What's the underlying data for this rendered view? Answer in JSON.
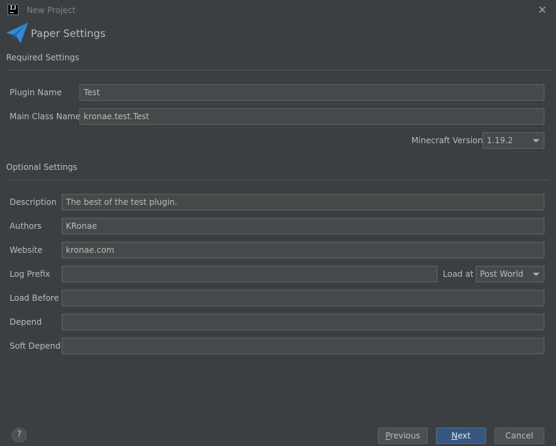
{
  "window": {
    "title": "New Project",
    "app_icon_text": "IJ"
  },
  "header": {
    "title": "Paper Settings",
    "icon": "paper-plane-icon",
    "accent": "#2f8dd8"
  },
  "required": {
    "section_title": "Required Settings",
    "plugin_name": {
      "label": "Plugin Name",
      "value": "Test"
    },
    "main_class": {
      "label": "Main Class Name",
      "value": "kronae.test.Test"
    },
    "minecraft_version": {
      "label": "Minecraft Version",
      "value": "1.19.2"
    }
  },
  "optional": {
    "section_title": "Optional Settings",
    "description": {
      "label": "Description",
      "value": "The best of the test plugin."
    },
    "authors": {
      "label": "Authors",
      "value": "KRonae"
    },
    "website": {
      "label": "Website",
      "value": "kronae.com"
    },
    "log_prefix": {
      "label": "Log Prefix",
      "value": ""
    },
    "load_at": {
      "label": "Load at",
      "value": "Post World"
    },
    "load_before": {
      "label": "Load Before",
      "value": ""
    },
    "depend": {
      "label": "Depend",
      "value": ""
    },
    "soft_depend": {
      "label": "Soft Depend",
      "value": ""
    }
  },
  "footer": {
    "help_label": "?",
    "previous": {
      "mnemonic": "P",
      "rest": "revious"
    },
    "next": {
      "mnemonic": "N",
      "rest": "ext"
    },
    "cancel": "Cancel"
  },
  "colors": {
    "background": "#3c3f41",
    "field_bg": "#45494a",
    "primary_button": "#365880"
  }
}
